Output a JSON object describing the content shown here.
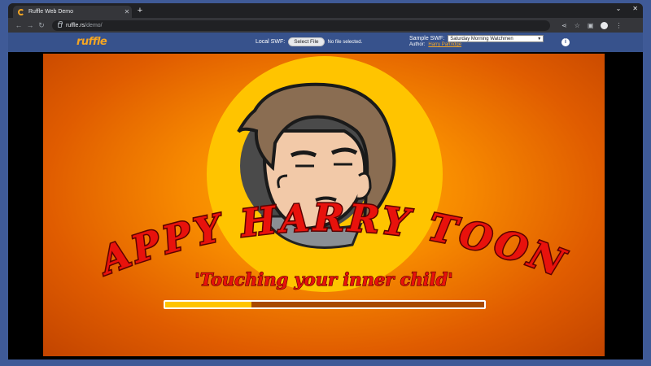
{
  "browser": {
    "tab": {
      "title": "Ruffle Web Demo",
      "close_glyph": "✕",
      "favicon": "ruffle-favicon"
    },
    "new_tab_glyph": "+",
    "window_controls": [
      "⌄",
      "✕"
    ],
    "nav": {
      "back": "←",
      "forward": "→",
      "reload": "↻"
    },
    "url": {
      "host": "ruffle.rs",
      "path": "/demo/"
    },
    "toolbar_icons": [
      "share-icon",
      "star-icon",
      "sidebar-icon",
      "profile-avatar",
      "menu-icon"
    ]
  },
  "ruffle": {
    "logo": "ruffle",
    "local_swf": {
      "label": "Local SWF:",
      "button": "Select File",
      "status": "No file selected."
    },
    "sample_swf": {
      "label": "Sample SWF:",
      "selected": "Saturday Morning Watchmen"
    },
    "author": {
      "label": "Author:",
      "name": "Harry Partridge"
    },
    "info_glyph": "i"
  },
  "stage": {
    "title": "HAPPY HARRY TOONS",
    "tagline": "'Touching your inner child'",
    "loading_progress": 0.27,
    "colors": {
      "bg_center": "#ffb000",
      "bg_edge": "#c24400",
      "circle": "#ffc400",
      "title": "#e8120c",
      "tagline": "#e8120c",
      "fill": "#ffc400"
    }
  }
}
